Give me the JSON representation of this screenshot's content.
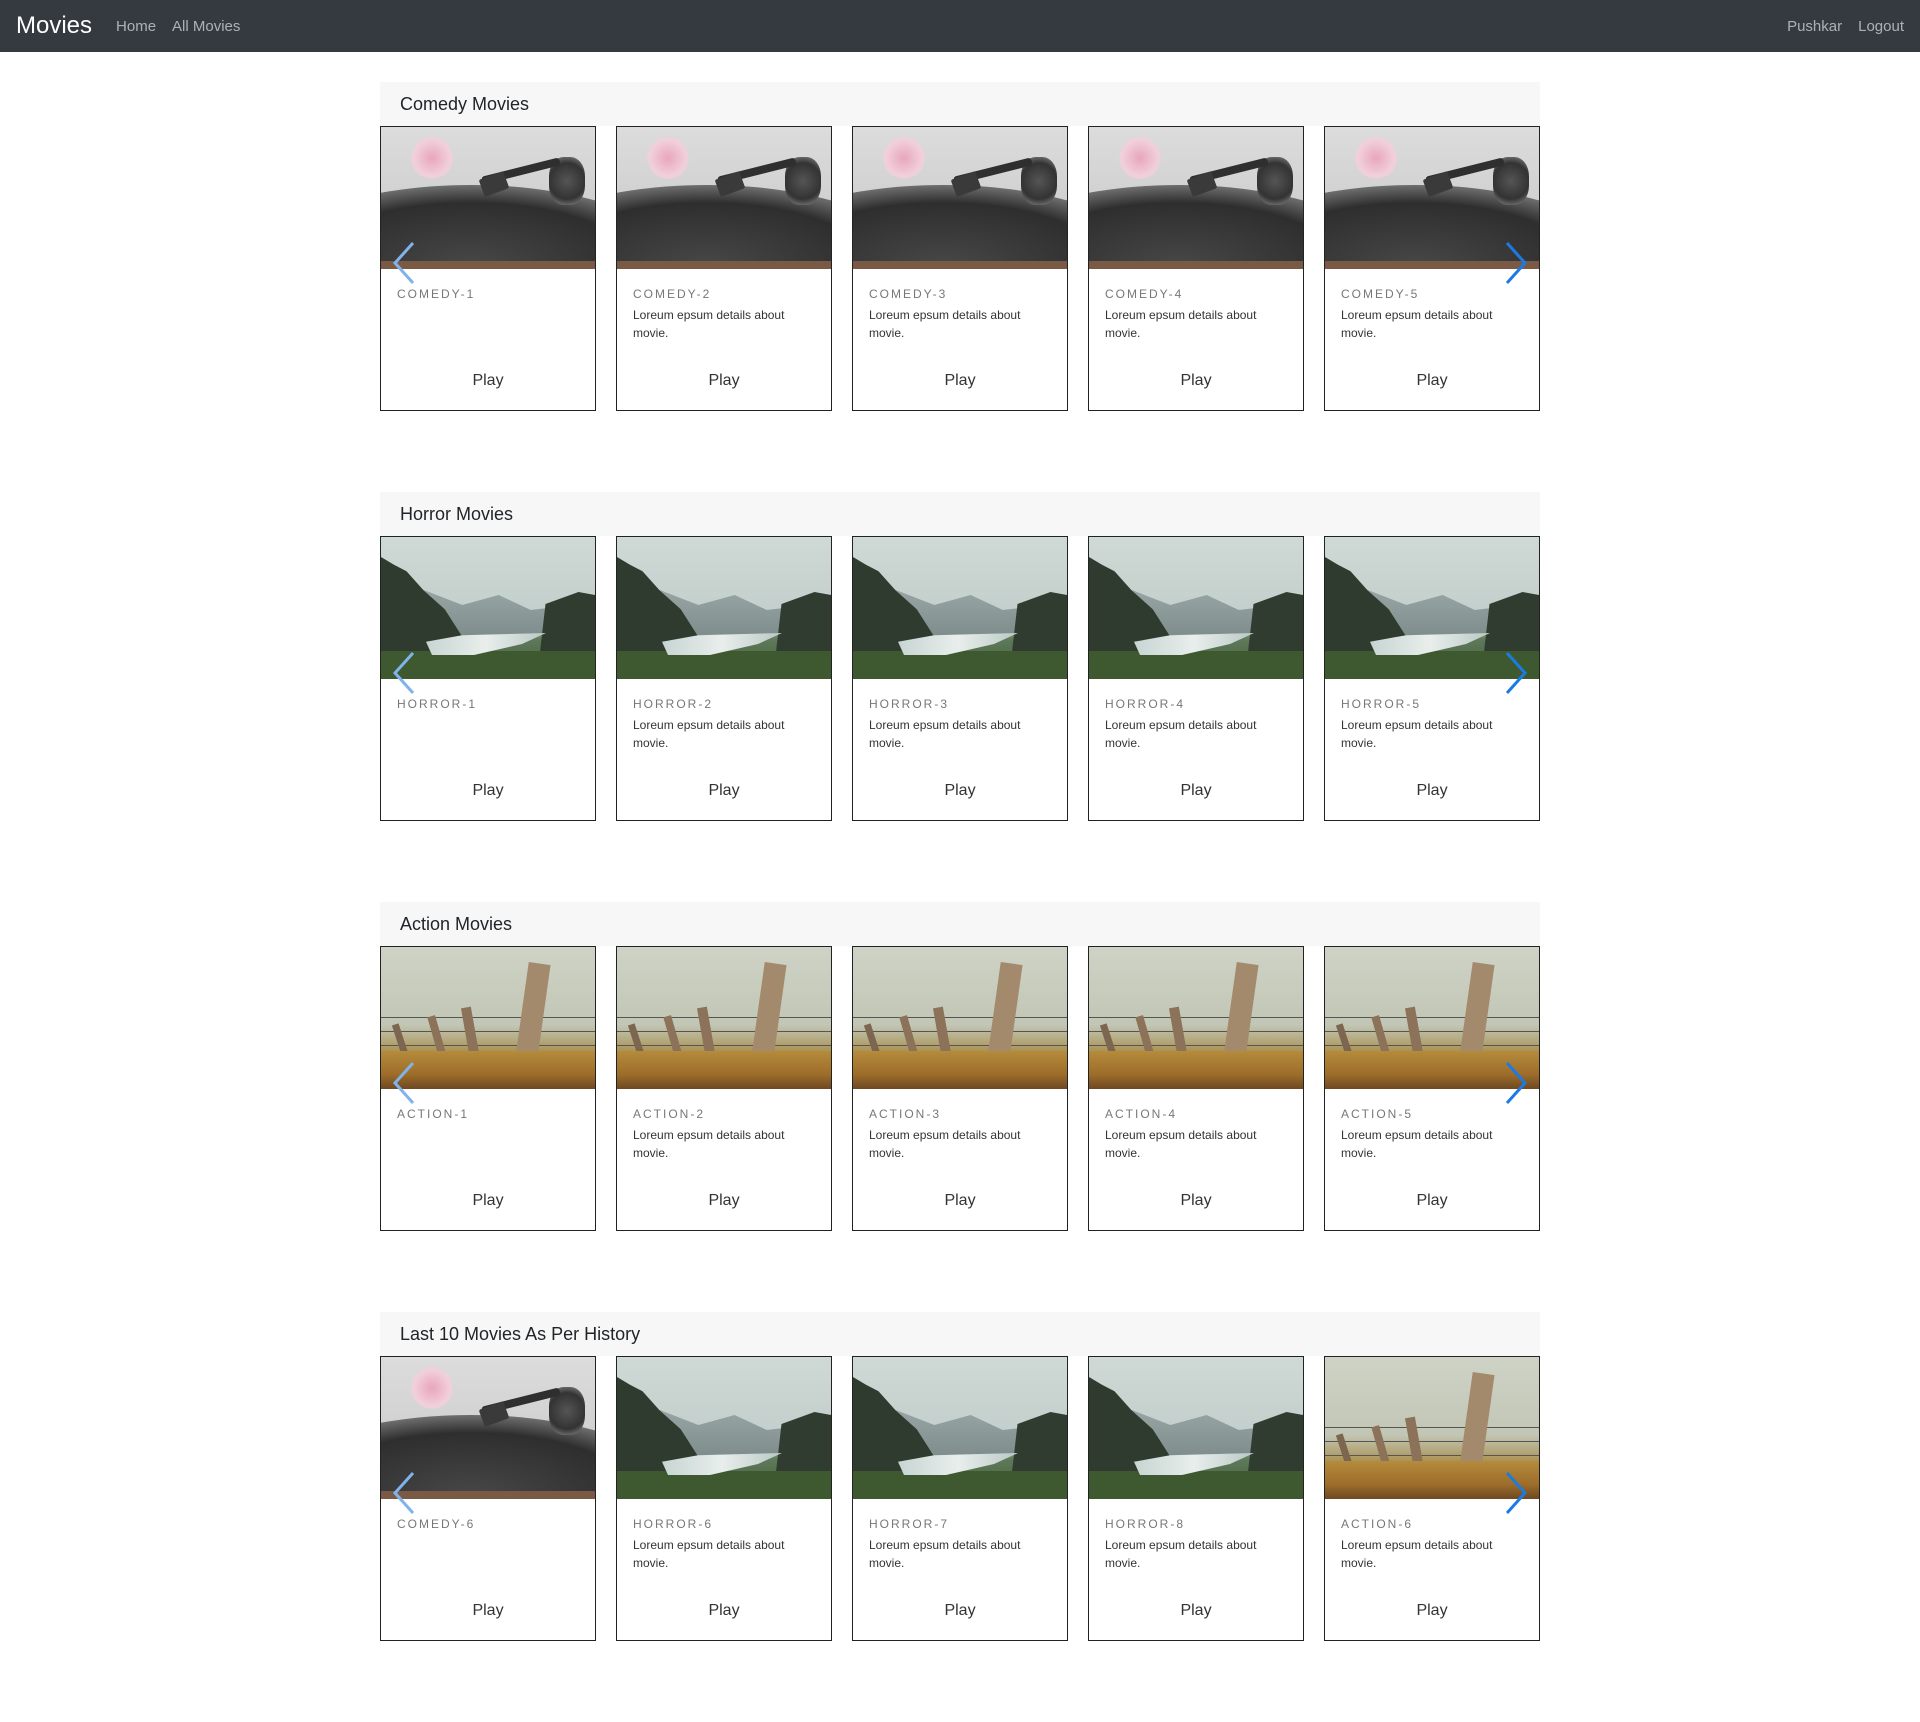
{
  "nav": {
    "brand": "Movies",
    "links": [
      "Home",
      "All Movies"
    ],
    "user": "Pushkar",
    "logout": "Logout"
  },
  "sections": [
    {
      "title": "Comedy Movies",
      "cards": [
        {
          "title": "COMEDY-1",
          "text": "",
          "image": "turntable"
        },
        {
          "title": "COMEDY-2",
          "text": "Loreum epsum details about movie.",
          "image": "turntable"
        },
        {
          "title": "COMEDY-3",
          "text": "Loreum epsum details about movie.",
          "image": "turntable"
        },
        {
          "title": "COMEDY-4",
          "text": "Loreum epsum details about movie.",
          "image": "turntable"
        },
        {
          "title": "COMEDY-5",
          "text": "Loreum epsum details about movie.",
          "image": "turntable"
        }
      ]
    },
    {
      "title": "Horror Movies",
      "cards": [
        {
          "title": "HORROR-1",
          "text": "",
          "image": "landscape"
        },
        {
          "title": "HORROR-2",
          "text": "Loreum epsum details about movie.",
          "image": "landscape"
        },
        {
          "title": "HORROR-3",
          "text": "Loreum epsum details about movie.",
          "image": "landscape"
        },
        {
          "title": "HORROR-4",
          "text": "Loreum epsum details about movie.",
          "image": "landscape"
        },
        {
          "title": "HORROR-5",
          "text": "Loreum epsum details about movie.",
          "image": "landscape"
        }
      ]
    },
    {
      "title": "Action Movies",
      "cards": [
        {
          "title": "ACTION-1",
          "text": "",
          "image": "fence"
        },
        {
          "title": "ACTION-2",
          "text": "Loreum epsum details about movie.",
          "image": "fence"
        },
        {
          "title": "ACTION-3",
          "text": "Loreum epsum details about movie.",
          "image": "fence"
        },
        {
          "title": "ACTION-4",
          "text": "Loreum epsum details about movie.",
          "image": "fence"
        },
        {
          "title": "ACTION-5",
          "text": "Loreum epsum details about movie.",
          "image": "fence"
        }
      ]
    },
    {
      "title": "Last 10 Movies As Per History",
      "cards": [
        {
          "title": "COMEDY-6",
          "text": "",
          "image": "turntable"
        },
        {
          "title": "HORROR-6",
          "text": "Loreum epsum details about movie.",
          "image": "landscape"
        },
        {
          "title": "HORROR-7",
          "text": "Loreum epsum details about movie.",
          "image": "landscape"
        },
        {
          "title": "HORROR-8",
          "text": "Loreum epsum details about movie.",
          "image": "landscape"
        },
        {
          "title": "ACTION-6",
          "text": "Loreum epsum details about movie.",
          "image": "fence"
        }
      ]
    }
  ],
  "play_label": "Play",
  "icons": {
    "prev": "chevron-left-icon",
    "next": "chevron-right-icon"
  },
  "colors": {
    "navbar_bg": "#343a40",
    "section_header_bg": "#f7f7f7",
    "arrow_next": "#1a7be3",
    "arrow_prev": "#7fb3ea"
  }
}
